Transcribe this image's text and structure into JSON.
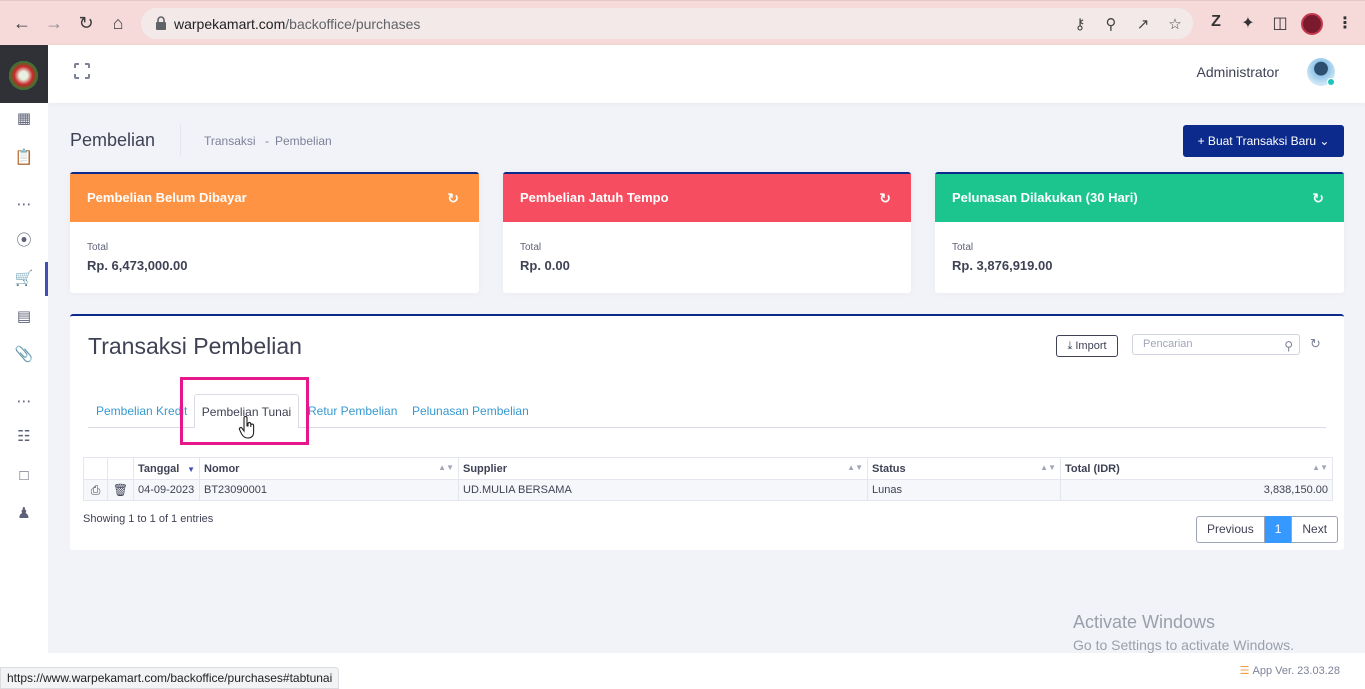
{
  "browser": {
    "url_host": "warpekamart.com",
    "url_path": "/backoffice/purchases",
    "status_url": "https://www.warpekamart.com/backoffice/purchases#tabtunai"
  },
  "header": {
    "user_name": "Administrator"
  },
  "subheader": {
    "title": "Pembelian",
    "crumb_1": "Transaksi",
    "crumb_sep": "-",
    "crumb_2": "Pembelian",
    "new_button": "+ Buat Transaksi Baru"
  },
  "cards": [
    {
      "title": "Pembelian Belum Dibayar",
      "label": "Total",
      "value": "Rp. 6,473,000.00",
      "color": "#fd9343"
    },
    {
      "title": "Pembelian Jatuh Tempo",
      "label": "Total",
      "value": "Rp. 0.00",
      "color": "#f64e60"
    },
    {
      "title": "Pelunasan Dilakukan (30 Hari)",
      "label": "Total",
      "value": "Rp. 3,876,919.00",
      "color": "#1bc58d"
    }
  ],
  "panel": {
    "title": "Transaksi Pembelian",
    "import_label": "Import",
    "search_placeholder": "Pencarian"
  },
  "tabs": [
    {
      "label": "Pembelian Kredit"
    },
    {
      "label": "Pembelian Tunai"
    },
    {
      "label": "Retur Pembelian"
    },
    {
      "label": "Pelunasan Pembelian"
    }
  ],
  "table": {
    "columns": [
      "Tanggal",
      "Nomor",
      "Supplier",
      "Status",
      "Total (IDR)"
    ],
    "rows": [
      {
        "tanggal": "04-09-2023",
        "nomor": "BT23090001",
        "supplier": "UD.MULIA BERSAMA",
        "status": "Lunas",
        "total": "3,838,150.00"
      }
    ],
    "info": "Showing 1 to 1 of 1 entries"
  },
  "pagination": {
    "previous": "Previous",
    "page": "1",
    "next": "Next"
  },
  "watermark": {
    "line1": "Activate Windows",
    "line2": "Go to Settings to activate Windows."
  },
  "footer": {
    "app_version": "App Ver. 23.03.28"
  },
  "colors": {
    "primary": "#0c2a8c",
    "link": "#3699d0",
    "highlight": "#e6168b"
  }
}
